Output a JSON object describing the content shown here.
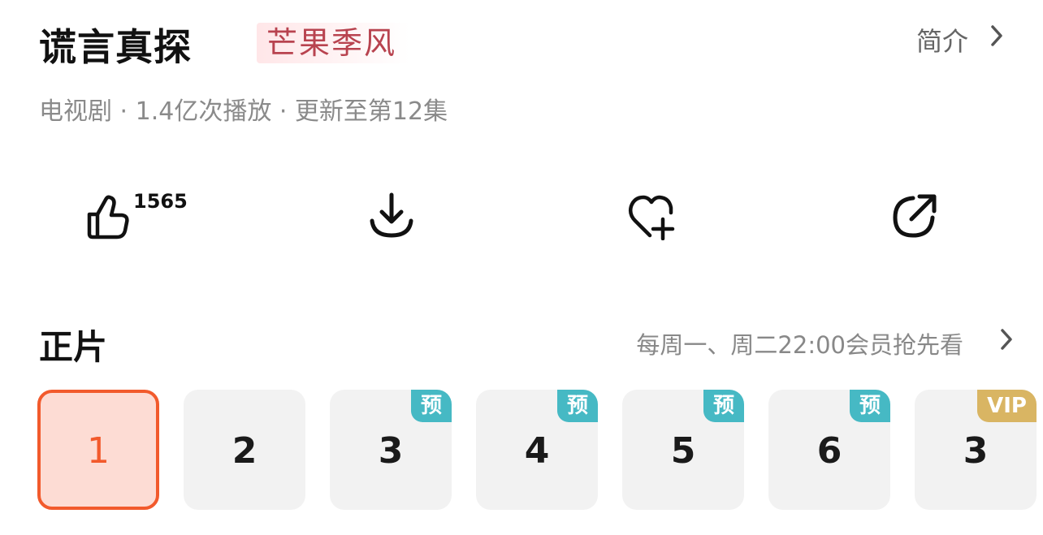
{
  "header": {
    "title": "谎言真探",
    "brand": "芒果季风",
    "intro_label": "简介"
  },
  "meta": "电视剧 · 1.4亿次播放 · 更新至第12集",
  "actions": {
    "like_count": "1565"
  },
  "section": {
    "title": "正片",
    "schedule": "每周一、周二22:00会员抢先看"
  },
  "episodes": [
    {
      "number": "1",
      "badge": ""
    },
    {
      "number": "2",
      "badge": ""
    },
    {
      "number": "3",
      "badge": "预"
    },
    {
      "number": "4",
      "badge": "预"
    },
    {
      "number": "5",
      "badge": "预"
    },
    {
      "number": "6",
      "badge": "预"
    },
    {
      "number": "3",
      "badge": "VIP"
    }
  ],
  "colors": {
    "accent": "#f25a2c",
    "active_bg": "#fddcd4",
    "preview_badge": "#46b9c4",
    "vip_badge": "#d9b563"
  }
}
